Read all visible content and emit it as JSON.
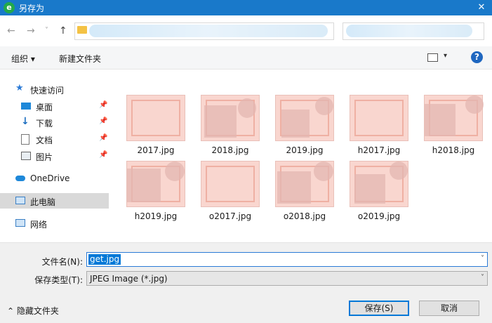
{
  "window": {
    "title": "另存为",
    "close_glyph": "✕",
    "app_icon_glyph": "e"
  },
  "address": {
    "back_glyph": "←",
    "forward_glyph": "→",
    "recent_glyph": "˅",
    "up_glyph": "↑",
    "dropdown_glyph": "˅"
  },
  "toolbar": {
    "organize_label": "组织 ▾",
    "new_folder_label": "新建文件夹",
    "view_caret": "▾",
    "help_glyph": "?"
  },
  "sidebar": {
    "items": [
      {
        "label": "快速访问",
        "icon": "star-icon"
      },
      {
        "label": "桌面",
        "icon": "desktop-icon",
        "pinned": true
      },
      {
        "label": "下载",
        "icon": "download-icon",
        "pinned": true
      },
      {
        "label": "文档",
        "icon": "document-icon",
        "pinned": true
      },
      {
        "label": "图片",
        "icon": "picture-icon",
        "pinned": true
      },
      {
        "label": "OneDrive",
        "icon": "cloud-icon"
      },
      {
        "label": "此电脑",
        "icon": "computer-icon",
        "selected": true
      },
      {
        "label": "网络",
        "icon": "network-icon"
      }
    ],
    "pin_glyph": "📌"
  },
  "files": [
    {
      "name": "2017.jpg"
    },
    {
      "name": "2018.jpg"
    },
    {
      "name": "2019.jpg"
    },
    {
      "name": "h2017.jpg"
    },
    {
      "name": "h2018.jpg"
    },
    {
      "name": "h2019.jpg"
    },
    {
      "name": "o2017.jpg"
    },
    {
      "name": "o2018.jpg"
    },
    {
      "name": "o2019.jpg"
    }
  ],
  "save": {
    "filename_label": "文件名(N):",
    "filename_value": "get.jpg",
    "type_label": "保存类型(T):",
    "type_value": "JPEG Image (*.jpg)",
    "hide_folders_label": "⌃ 隐藏文件夹",
    "save_button": "保存(S)",
    "cancel_button": "取消",
    "caret": "˅"
  },
  "colors": {
    "titlebar": "#1979ca",
    "accent": "#0078d7",
    "thumbnail": "#f9d6cf"
  }
}
